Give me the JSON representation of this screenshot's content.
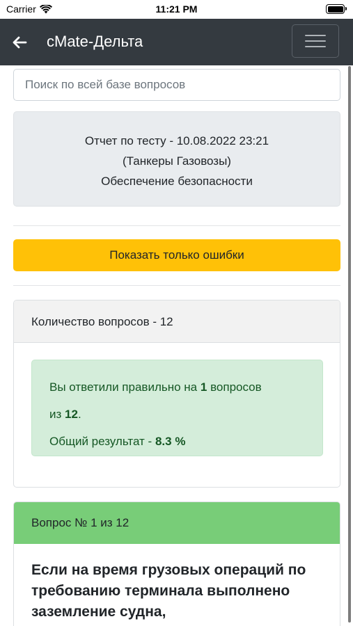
{
  "status_bar": {
    "carrier": "Carrier",
    "time": "11:21 PM"
  },
  "navbar": {
    "title": "cMate-Дельта",
    "back_icon": "arrow-left-icon",
    "menu_icon": "hamburger-icon"
  },
  "search": {
    "placeholder": "Поиск по всей базе вопросов",
    "value": ""
  },
  "report": {
    "line1": "Отчет по тесту - 10.08.2022 23:21",
    "line2": "(Танкеры Газовозы)",
    "line3": "Обеспечение безопасности"
  },
  "errors_button": {
    "label": "Показать только ошибки",
    "color": "#ffc107"
  },
  "summary": {
    "header": "Количество вопросов - 12",
    "answered_prefix": "Вы ответили правильно на",
    "correct_count": "1",
    "answered_suffix": "вопросов",
    "of_prefix": "из",
    "total_count": "12",
    "of_suffix": ".",
    "result_prefix": "Общий результат -",
    "result_value": "8.3 %",
    "alert_color": "#d4edda"
  },
  "question": {
    "header": "Вопрос № 1 из 12",
    "header_color": "#78cd78",
    "text": "Если на время грузовых операций по требованию терминала выполнено заземление судна,"
  }
}
